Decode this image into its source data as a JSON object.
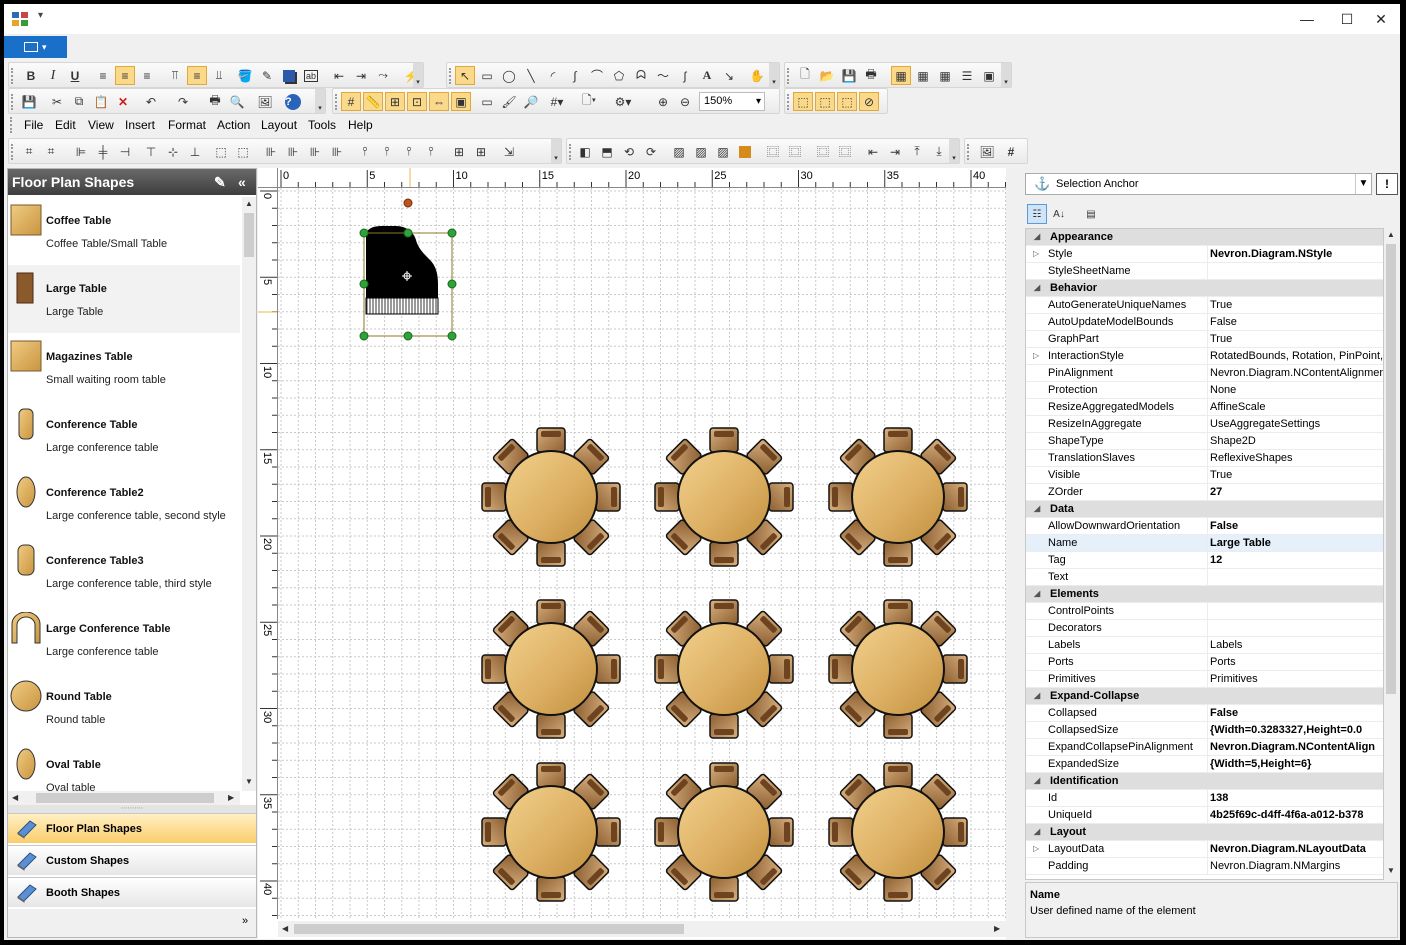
{
  "window": {
    "controls": {
      "minimize": "—",
      "maximize": "☐",
      "close": "✕"
    }
  },
  "app_menu": {
    "icon": "app-menu-icon"
  },
  "toolbar": {
    "bold": "B",
    "italic": "I",
    "underline": "U",
    "zoom_value": "150%"
  },
  "menu": [
    "File",
    "Edit",
    "View",
    "Insert",
    "Format",
    "Action",
    "Layout",
    "Tools",
    "Help"
  ],
  "left_panel": {
    "title": "Floor Plan Shapes",
    "shapes": [
      {
        "title": "Coffee Table",
        "desc": "Coffee Table/Small Table",
        "thumb": "coffee-table"
      },
      {
        "title": "Large Table",
        "desc": "Large Table",
        "thumb": "large-table"
      },
      {
        "title": "Magazines Table",
        "desc": "Small waiting room table",
        "thumb": "magazines-table"
      },
      {
        "title": "Conference Table",
        "desc": "Large conference table",
        "thumb": "conference-table"
      },
      {
        "title": "Conference Table2",
        "desc": "Large conference table, second style",
        "thumb": "conference-table2"
      },
      {
        "title": "Conference Table3",
        "desc": "Large conference table, third style",
        "thumb": "conference-table3"
      },
      {
        "title": "Large Conference Table",
        "desc": "Large conference table",
        "thumb": "large-conference-table"
      },
      {
        "title": "Round Table",
        "desc": "Round table",
        "thumb": "round-table"
      },
      {
        "title": "Oval Table",
        "desc": "Oval table",
        "thumb": "oval-table"
      }
    ],
    "categories": [
      "Floor Plan Shapes",
      "Custom Shapes",
      "Booth Shapes"
    ],
    "active_category": 0
  },
  "ruler": {
    "h_labels": [
      "0",
      "5",
      "10",
      "15",
      "20",
      "25",
      "30",
      "35",
      "40"
    ],
    "v_labels": [
      "0",
      "5",
      "10",
      "15",
      "20",
      "25",
      "30",
      "35",
      "40"
    ]
  },
  "right_panel": {
    "selector": "Selection Anchor",
    "anchor_button": "!",
    "properties": [
      {
        "type": "cat",
        "name": "Appearance"
      },
      {
        "name": "Style",
        "value": "Nevron.Diagram.NStyle",
        "bold": true,
        "expand": true
      },
      {
        "name": "StyleSheetName",
        "value": ""
      },
      {
        "type": "cat",
        "name": "Behavior"
      },
      {
        "name": "AutoGenerateUniqueNames",
        "value": "True"
      },
      {
        "name": "AutoUpdateModelBounds",
        "value": "False"
      },
      {
        "name": "GraphPart",
        "value": "True"
      },
      {
        "name": "InteractionStyle",
        "value": "RotatedBounds, Rotation, PinPoint, S",
        "expand": true
      },
      {
        "name": "PinAlignment",
        "value": "Nevron.Diagram.NContentAlignment"
      },
      {
        "name": "Protection",
        "value": "None"
      },
      {
        "name": "ResizeAggregatedModels",
        "value": "AffineScale"
      },
      {
        "name": "ResizeInAggregate",
        "value": "UseAggregateSettings"
      },
      {
        "name": "ShapeType",
        "value": "Shape2D"
      },
      {
        "name": "TranslationSlaves",
        "value": "ReflexiveShapes"
      },
      {
        "name": "Visible",
        "value": "True"
      },
      {
        "name": "ZOrder",
        "value": "27",
        "bold": true
      },
      {
        "type": "cat",
        "name": "Data"
      },
      {
        "name": "AllowDownwardOrientation",
        "value": "False",
        "bold": true
      },
      {
        "name": "Name",
        "value": "Large Table",
        "bold": true,
        "selected": true
      },
      {
        "name": "Tag",
        "value": "12",
        "bold": true
      },
      {
        "name": "Text",
        "value": ""
      },
      {
        "type": "cat",
        "name": "Elements"
      },
      {
        "name": "ControlPoints",
        "value": ""
      },
      {
        "name": "Decorators",
        "value": ""
      },
      {
        "name": "Labels",
        "value": "Labels"
      },
      {
        "name": "Ports",
        "value": "Ports"
      },
      {
        "name": "Primitives",
        "value": "Primitives"
      },
      {
        "type": "cat",
        "name": "Expand-Collapse"
      },
      {
        "name": "Collapsed",
        "value": "False",
        "bold": true
      },
      {
        "name": "CollapsedSize",
        "value": "{Width=0.3283327,Height=0.0",
        "bold": true
      },
      {
        "name": "ExpandCollapsePinAlignment",
        "value": "Nevron.Diagram.NContentAlign",
        "bold": true
      },
      {
        "name": "ExpandedSize",
        "value": "{Width=5,Height=6}",
        "bold": true
      },
      {
        "type": "cat",
        "name": "Identification"
      },
      {
        "name": "Id",
        "value": "138",
        "bold": true
      },
      {
        "name": "UniqueId",
        "value": "4b25f69c-d4ff-4f6a-a012-b378",
        "bold": true
      },
      {
        "type": "cat",
        "name": "Layout"
      },
      {
        "name": "LayoutData",
        "value": "Nevron.Diagram.NLayoutData",
        "bold": true,
        "expand": true
      },
      {
        "name": "Padding",
        "value": "Nevron.Diagram.NMargins"
      }
    ],
    "help_title": "Name",
    "help_desc": "User defined name of the element"
  },
  "colors": {
    "accent": "#1a6fc9",
    "table_fill": "#e3b45e",
    "chair_fill": "#a87a4a",
    "selection_handle": "#2fa23a"
  }
}
